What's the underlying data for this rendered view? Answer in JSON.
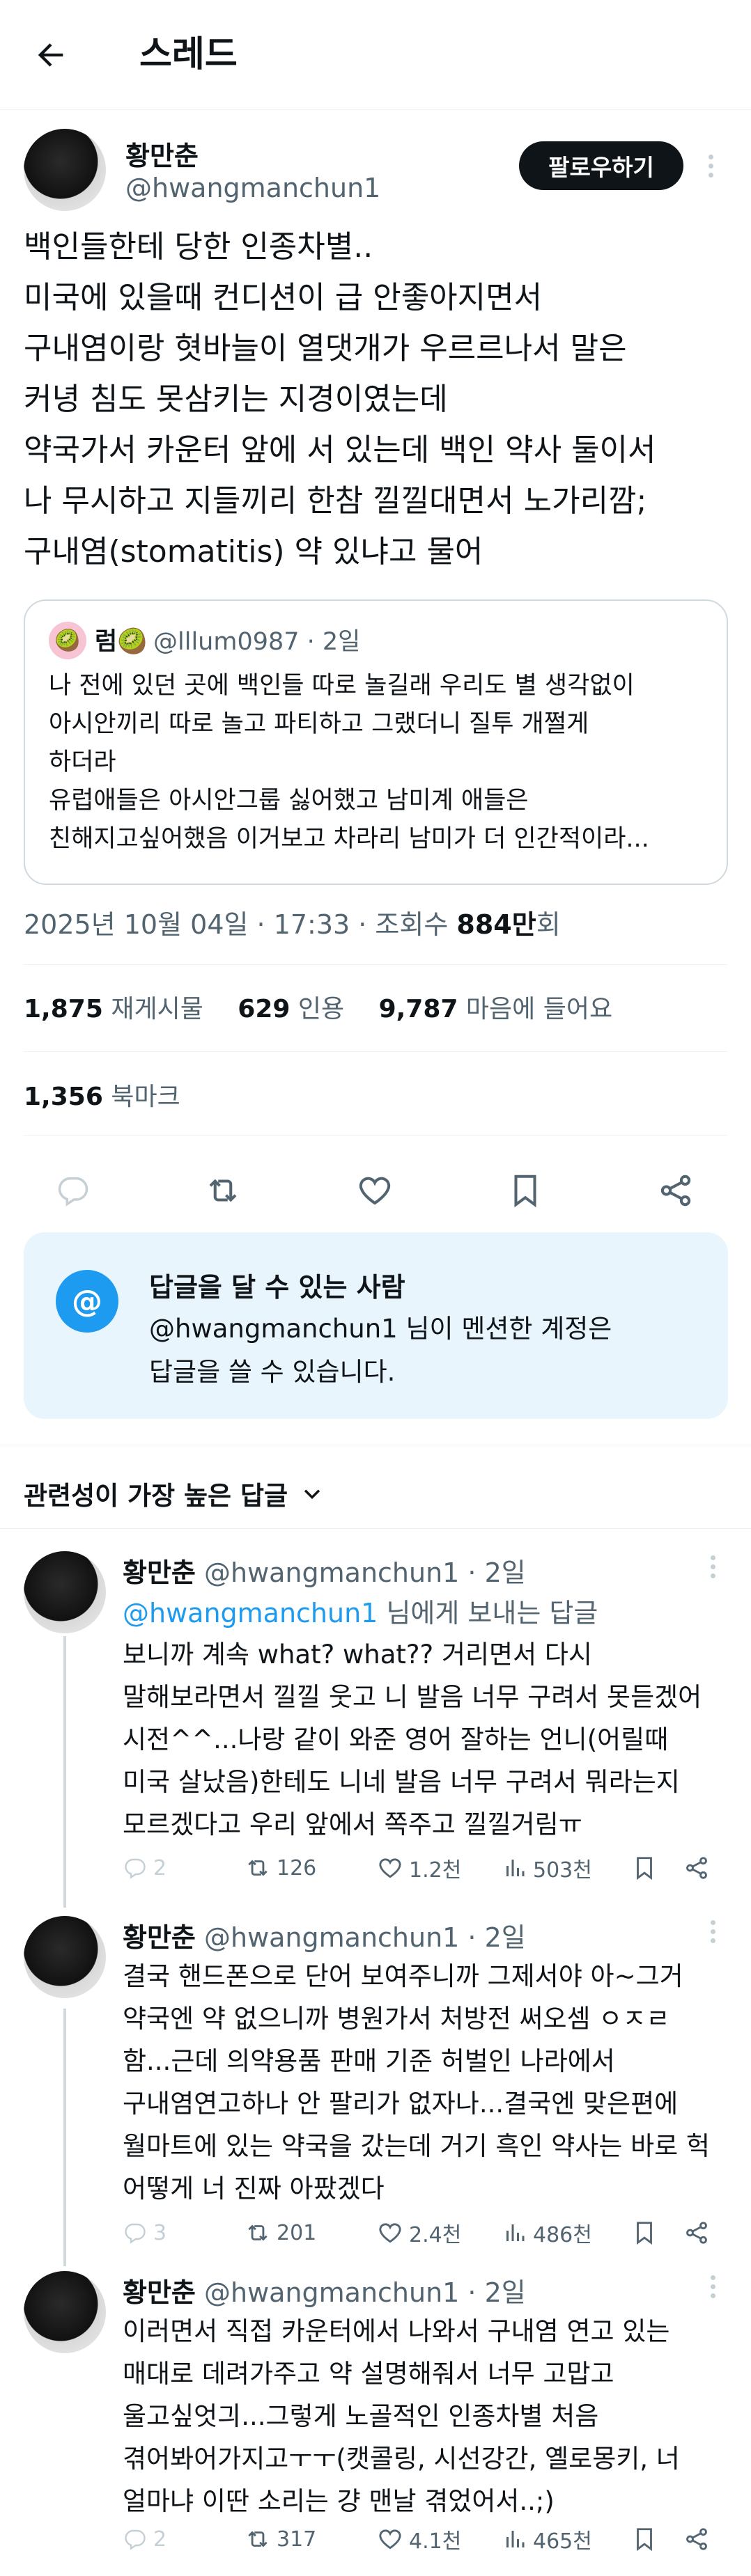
{
  "header": {
    "title": "스레드",
    "back_icon": "arrow-left-icon"
  },
  "post": {
    "author": {
      "name": "황만춘",
      "handle": "@hwangmanchun1"
    },
    "follow_label": "팔로우하기",
    "lines": [
      "백인들한테 당한 인종차별..",
      "미국에 있을때 컨디션이 급 안좋아지면서",
      "구내염이랑 혓바늘이 열댓개가 우르르나서 말은",
      "커녕 침도 못삼키는 지경이였는데",
      "약국가서 카운터 앞에 서 있는데 백인 약사 둘이서",
      "나 무시하고 지들끼리 한참 낄낄대면서 노가리깜;",
      "구내염(stomatitis) 약 있냐고 물어"
    ],
    "quote": {
      "avatar_emoji": "🥝",
      "name": "럼🥝",
      "handle": "@lllum0987 · 2일",
      "lines": [
        "나 전에 있던 곳에 백인들 따로 놀길래 우리도 별 생각없이",
        "아시안끼리 따로 놀고 파티하고 그랬더니 질투 개쩔게",
        "하더라",
        "유럽애들은 아시안그룹 싫어했고 남미계 애들은",
        "친해지고싶어했음 이거보고 차라리 남미가 더 인간적이라..."
      ]
    },
    "meta": {
      "date": "2025년 10월 04일 · 17:33 · 조회수 ",
      "views": "884만",
      "views_suffix": "회"
    },
    "stats": {
      "reposts": "1,875",
      "reposts_label": "재게시물",
      "quotes": "629",
      "quotes_label": "인용",
      "likes": "9,787",
      "likes_label": "마음에 들어요"
    },
    "bookmarks": {
      "count": "1,356",
      "label": "북마크"
    }
  },
  "reply_restriction": {
    "title": "답글을 달 수 있는 사람",
    "desc_line1": "@hwangmanchun1 님이 멘션한 계정은",
    "desc_line2": "답글을 쓸 수 있습니다.",
    "icon": "@"
  },
  "sort": {
    "label": "관련성이 가장 높은 답글"
  },
  "replies": [
    {
      "name": "황만춘",
      "meta": "@hwangmanchun1 · 2일",
      "to_handle": "@hwangmanchun1",
      "to_suffix": " 님에게 보내는 답글",
      "lines": [
        "보니까 계속 what? what?? 거리면서 다시",
        "말해보라면서 낄낄 웃고 니 발음 너무 구려서 못듣겠어",
        "시전^^...나랑 같이 와준 영어 잘하는 언니(어릴때",
        "미국 살났음)한테도 니네 발음 너무 구려서 뭐라는지",
        "모르겠다고 우리 앞에서 쪽주고 낄낄거림ㅠ"
      ],
      "replies": "2",
      "reposts": "126",
      "likes": "1.2천",
      "views": "503천"
    },
    {
      "name": "황만춘",
      "meta": "@hwangmanchun1 · 2일",
      "lines": [
        "결국 핸드폰으로 단어 보여주니까 그제서야 아~그거",
        "약국엔 약 없으니까 병원가서 처방전 써오셈 ㅇㅈㄹ",
        "함...근데 의약용품 판매 기준 허벌인 나라에서",
        "구내염연고하나 안 팔리가 없자나...결국엔 맞은편에",
        "월마트에 있는 약국을 갔는데 거기 흑인 약사는 바로 헉",
        "어떻게 너 진짜 아팠겠다"
      ],
      "replies": "3",
      "reposts": "201",
      "likes": "2.4천",
      "views": "486천"
    },
    {
      "name": "황만춘",
      "meta": "@hwangmanchun1 · 2일",
      "lines": [
        "이러면서 직접 카운터에서 나와서 구내염 연고 있는",
        "매대로 데려가주고 약 설명해줘서 너무 고맙고",
        "울고싶엇긔...그렇게 노골적인 인종차별 처음",
        "겪어봐어가지고ㅜㅜ(캣콜링, 시선강간, 옐로몽키, 너",
        "얼마냐 이딴 소리는 걍 맨날 겪었어서..;)"
      ],
      "replies": "2",
      "reposts": "317",
      "likes": "4.1천",
      "views": "465천"
    }
  ]
}
